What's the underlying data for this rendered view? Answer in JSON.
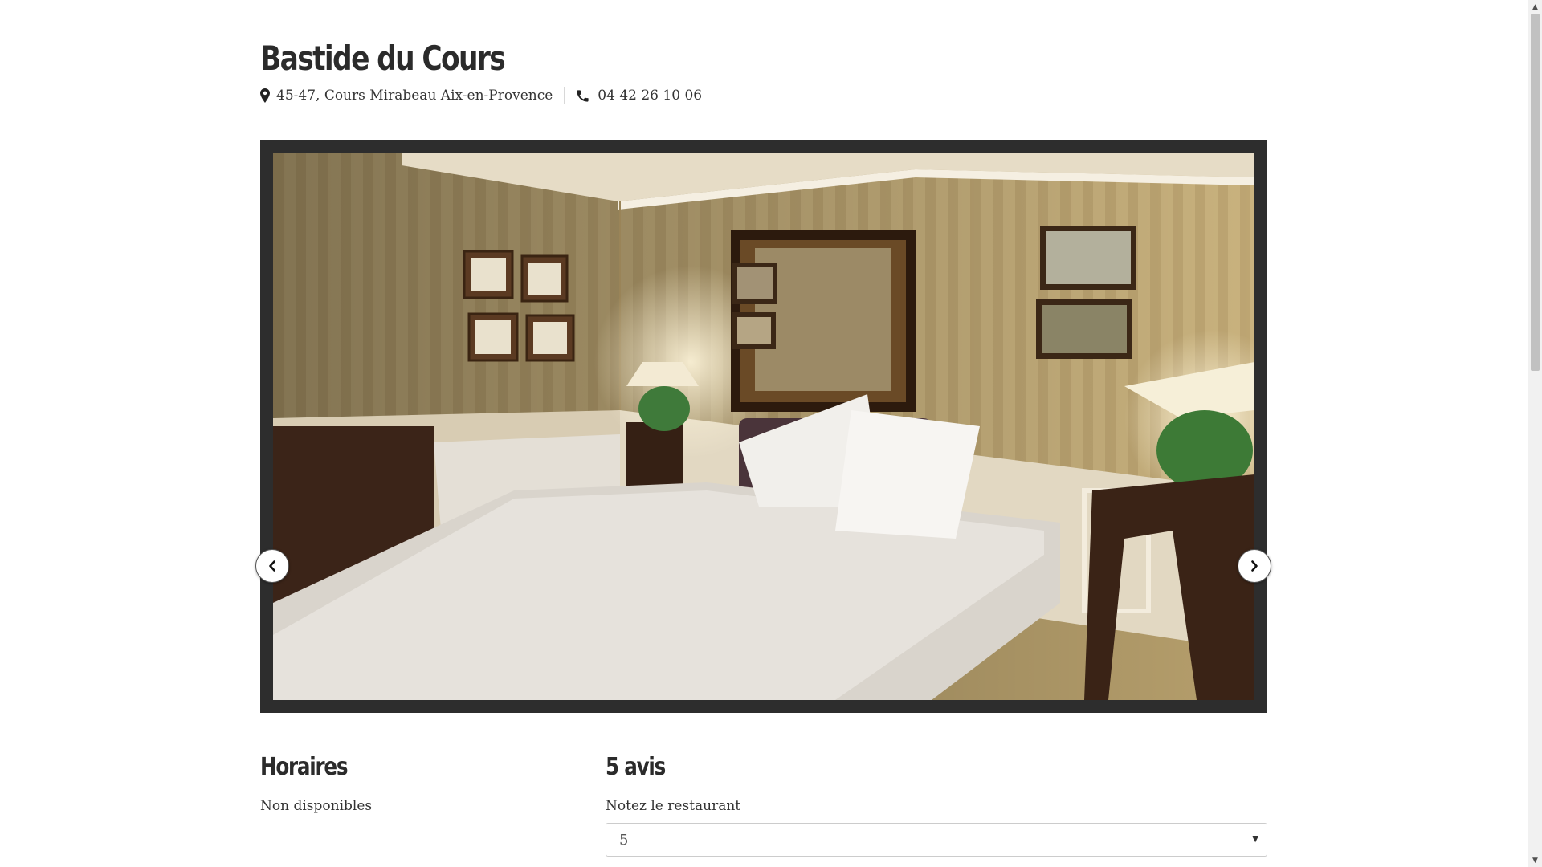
{
  "restaurant": {
    "name": "Bastide du Cours",
    "address": "45-47, Cours Mirabeau Aix-en-Provence",
    "phone": "04 42 26 10 06"
  },
  "icons": {
    "address": "map-marker-icon",
    "phone": "phone-icon",
    "prev": "chevron-left-icon",
    "next": "chevron-right-icon"
  },
  "carousel": {
    "current_photo": "hotel-bedroom-photo"
  },
  "hours": {
    "title": "Horaires",
    "value": "Non disponibles"
  },
  "reviews": {
    "title": "5 avis",
    "rate_label": "Notez le restaurant",
    "rating_selected": "5"
  },
  "colors": {
    "carousel_frame": "#2d2d2d",
    "text": "#333333",
    "heading": "#2b2b2b"
  }
}
